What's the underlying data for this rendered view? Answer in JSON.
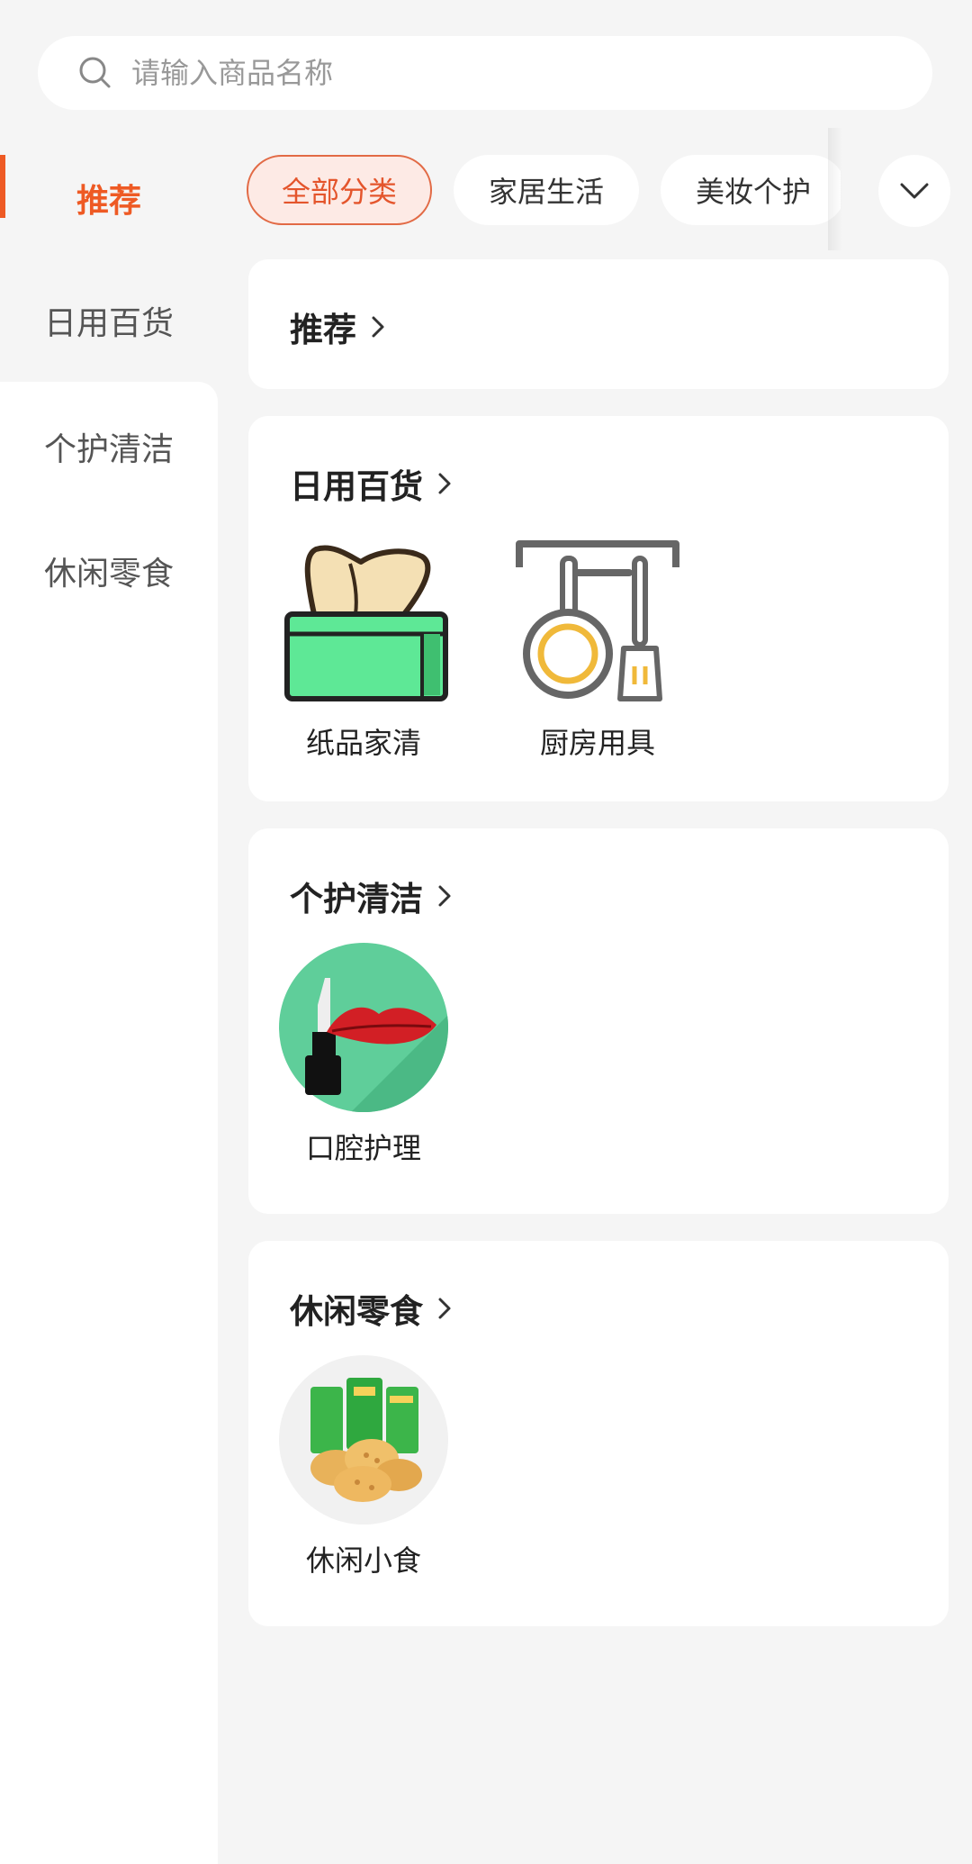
{
  "search": {
    "placeholder": "请输入商品名称"
  },
  "sidebar": {
    "items": [
      {
        "label": "推荐",
        "active": true
      },
      {
        "label": "日用百货"
      },
      {
        "label": "个护清洁"
      },
      {
        "label": "休闲零食"
      }
    ]
  },
  "chips": [
    {
      "label": "全部分类",
      "active": true
    },
    {
      "label": "家居生活"
    },
    {
      "label": "美妆个护"
    }
  ],
  "sections": [
    {
      "title": "推荐",
      "items": []
    },
    {
      "title": "日用百货",
      "items": [
        {
          "label": "纸品家清",
          "icon": "tissue-box-icon"
        },
        {
          "label": "厨房用具",
          "icon": "kitchen-utensils-icon"
        }
      ]
    },
    {
      "title": "个护清洁",
      "items": [
        {
          "label": "口腔护理",
          "icon": "lipstick-lips-icon"
        }
      ]
    },
    {
      "title": "休闲零食",
      "items": [
        {
          "label": "休闲小食",
          "icon": "biscuits-snack-icon"
        }
      ]
    }
  ],
  "colors": {
    "accent": "#ee5a24",
    "chip_active_bg": "#fdeae5",
    "page_bg": "#f5f5f5"
  }
}
